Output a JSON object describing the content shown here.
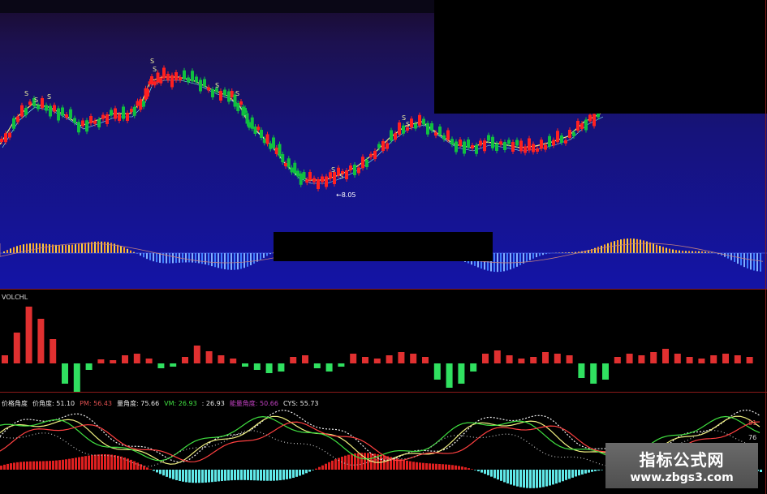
{
  "main": {
    "signal_labels": [
      "S",
      "S",
      "S",
      "S",
      "S",
      "S",
      "S",
      "S",
      "S",
      "S",
      "S"
    ],
    "arrow_label": "←8.05"
  },
  "vol": {
    "title": "VOLCHL"
  },
  "osc": {
    "labels": [
      {
        "text": "价格角度",
        "color": "#e8e8e8"
      },
      {
        "text": "价角度: 51.10",
        "color": "#e8e8e8"
      },
      {
        "text": "PM: 56.43",
        "color": "#e05050"
      },
      {
        "text": "量角度: 75.66",
        "color": "#e8e8e8"
      },
      {
        "text": "VM: 26.93",
        "color": "#40e040"
      },
      {
        "text": ": 26.93",
        "color": "#e8e8e8"
      },
      {
        "text": "能量角度: 50.66",
        "color": "#c040c0"
      },
      {
        "text": "CYS: 55.73",
        "color": "#e8e8e8"
      }
    ],
    "right_values": [
      "81",
      "76"
    ]
  },
  "watermark": {
    "title": "指标公式网",
    "url": "www.zbgs3.com"
  },
  "colors": {
    "up": "#ff2020",
    "down": "#10c040",
    "ma": "#f0f080",
    "cyan": "#60e8e8"
  }
}
